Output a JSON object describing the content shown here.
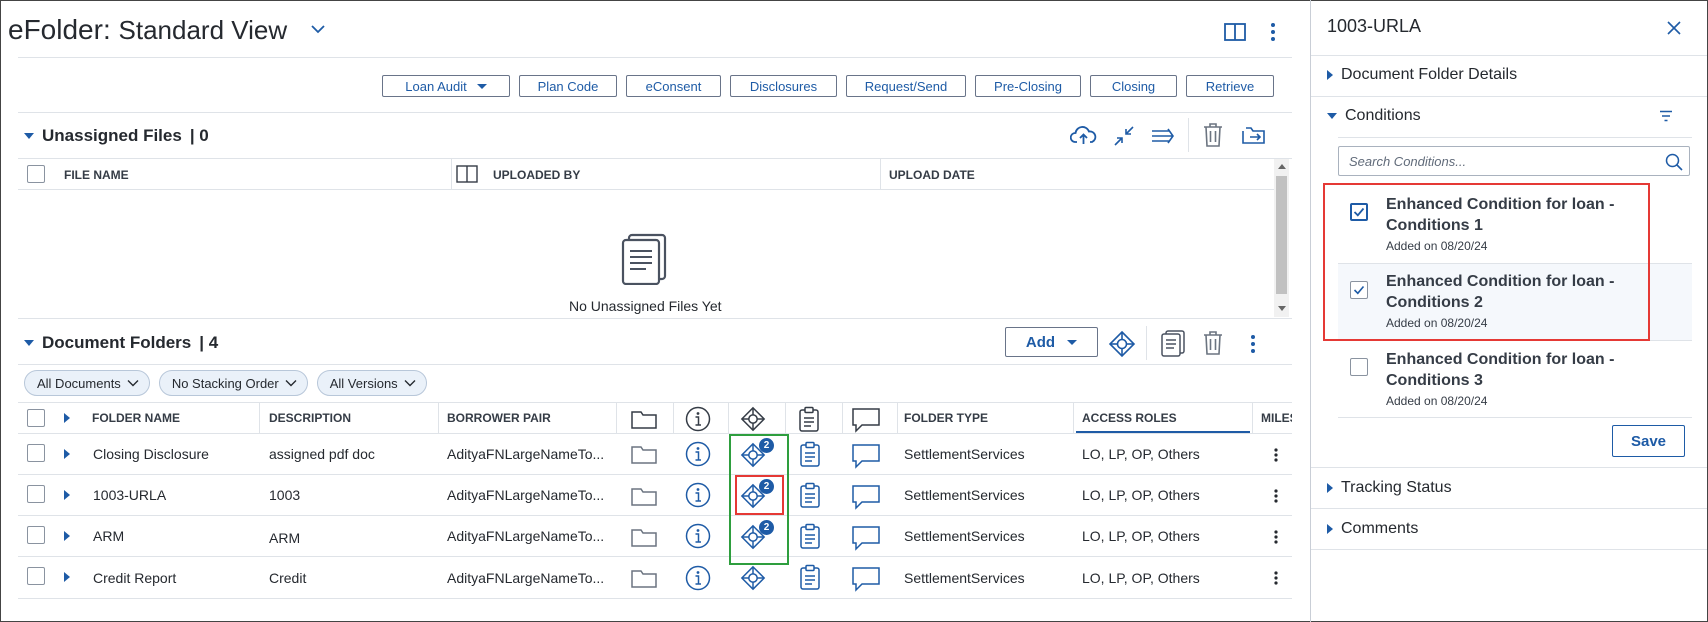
{
  "header": {
    "title_main": "eFolder:",
    "title_view": "Standard View"
  },
  "toolbar": {
    "buttons": [
      "Loan Audit",
      "Plan Code",
      "eConsent",
      "Disclosures",
      "Request/Send",
      "Pre-Closing",
      "Closing",
      "Retrieve"
    ]
  },
  "unassigned": {
    "title": "Unassigned Files",
    "count": "| 0",
    "columns": [
      "FILE NAME",
      "UPLOADED BY",
      "UPLOAD DATE"
    ],
    "empty_text": "No Unassigned Files Yet"
  },
  "folders": {
    "title": "Document Folders",
    "count": "| 4",
    "add_label": "Add",
    "filters": [
      "All Documents",
      "No Stacking Order",
      "All Versions"
    ],
    "columns": {
      "folder_name": "FOLDER NAME",
      "description": "DESCRIPTION",
      "borrower_pair": "BORROWER PAIR",
      "folder_type": "FOLDER TYPE",
      "access_roles": "ACCESS ROLES",
      "milestone": "MILES"
    },
    "rows": [
      {
        "name": "Closing Disclosure",
        "description": "assigned pdf doc",
        "borrower": "AdityaFNLargeNameTo...",
        "type": "SettlementServices",
        "roles": "LO, LP, OP, Others",
        "badge": "2"
      },
      {
        "name": "1003-URLA",
        "description": "1003",
        "borrower": "AdityaFNLargeNameTo...",
        "type": "SettlementServices",
        "roles": "LO, LP, OP, Others",
        "badge": "2"
      },
      {
        "name": "ARM",
        "description": "ARM",
        "borrower": "AdityaFNLargeNameTo...",
        "type": "SettlementServices",
        "roles": "LO, LP, OP, Others",
        "badge": "2"
      },
      {
        "name": "Credit Report",
        "description": "Credit",
        "borrower": "AdityaFNLargeNameTo...",
        "type": "SettlementServices",
        "roles": "LO, LP, OP, Others",
        "badge": ""
      }
    ]
  },
  "panel": {
    "title": "1003-URLA",
    "sections": {
      "details": "Document Folder Details",
      "conditions": "Conditions",
      "tracking": "Tracking Status",
      "comments": "Comments"
    },
    "search_placeholder": "Search Conditions...",
    "conditions": [
      {
        "line1": "Enhanced Condition for loan -",
        "line2": "Conditions 1",
        "date": "Added on 08/20/24",
        "checked": true
      },
      {
        "line1": "Enhanced Condition for loan -",
        "line2": "Conditions 2",
        "date": "Added on 08/20/24",
        "checked": true
      },
      {
        "line1": "Enhanced Condition for loan -",
        "line2": "Conditions 3",
        "date": "Added on 08/20/24",
        "checked": false
      }
    ],
    "save_label": "Save"
  },
  "colors": {
    "accent": "#1e5ba6",
    "highlight_red": "#e53935",
    "highlight_green": "#2e9e3e"
  }
}
